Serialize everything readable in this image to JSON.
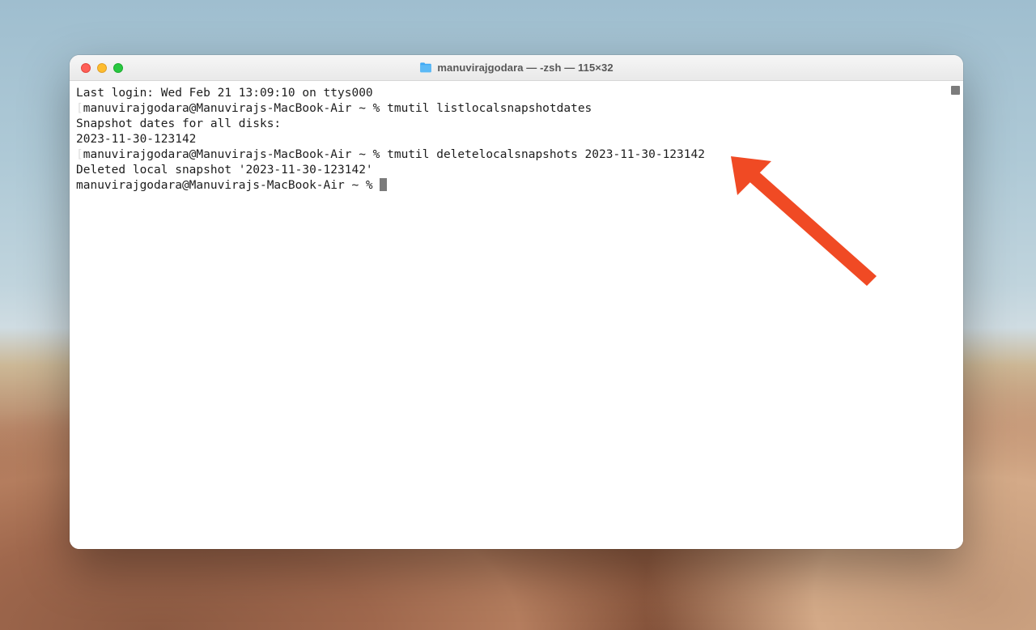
{
  "window": {
    "title": "manuvirajgodara — -zsh — 115×32"
  },
  "terminal": {
    "lines": [
      {
        "text": "Last login: Wed Feb 21 13:09:10 on ttys000"
      },
      {
        "prompt": "manuvirajgodara@Manuvirajs-MacBook-Air ~ % ",
        "cmd": "tmutil listlocalsnapshotdates",
        "bracket": true
      },
      {
        "text": "Snapshot dates for all disks:"
      },
      {
        "text": "2023-11-30-123142"
      },
      {
        "prompt": "manuvirajgodara@Manuvirajs-MacBook-Air ~ % ",
        "cmd": "tmutil deletelocalsnapshots 2023-11-30-123142",
        "bracket": true
      },
      {
        "text": "Deleted local snapshot '2023-11-30-123142'"
      },
      {
        "prompt": "manuvirajgodara@Manuvirajs-MacBook-Air ~ % ",
        "cursor": true
      }
    ]
  },
  "annotation": {
    "arrow_color": "#f04a24"
  }
}
